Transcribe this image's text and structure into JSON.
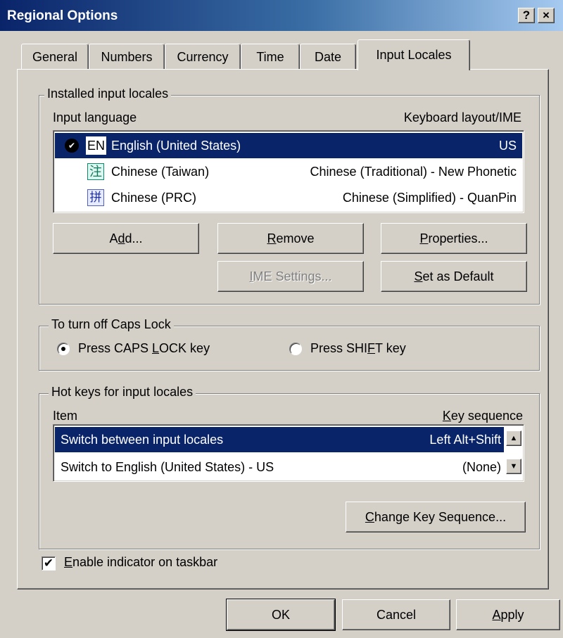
{
  "window": {
    "title": "Regional Options",
    "help_glyph": "?",
    "close_glyph": "×"
  },
  "tabs": [
    {
      "label": "General"
    },
    {
      "label": "Numbers"
    },
    {
      "label": "Currency"
    },
    {
      "label": "Time"
    },
    {
      "label": "Date"
    },
    {
      "label": "Input Locales",
      "active": true
    }
  ],
  "installed": {
    "legend": "Installed input locales",
    "col_language": "Input language",
    "col_layout": "Keyboard layout/IME",
    "rows": [
      {
        "badge": "EN",
        "language": "English (United States)",
        "layout": "US",
        "selected": true,
        "checked": true,
        "icon": "en-locale-icon"
      },
      {
        "badge": "",
        "language": "Chinese (Taiwan)",
        "layout": "Chinese (Traditional) - New Phonetic",
        "selected": false,
        "icon": "phonetic-ime-icon"
      },
      {
        "badge": "",
        "language": "Chinese (PRC)",
        "layout": "Chinese (Simplified) - QuanPin",
        "selected": false,
        "icon": "quanpin-ime-icon"
      }
    ],
    "check_mark": "✔",
    "phonetic_glyph": "注",
    "quanpin_glyph": "拼",
    "buttons": {
      "add_pre": "A",
      "add_key": "d",
      "add_post": "d...",
      "remove_key": "R",
      "remove_post": "emove",
      "properties_key": "P",
      "properties_post": "roperties...",
      "ime_key": "I",
      "ime_post": "ME Settings...",
      "default_key": "S",
      "default_post": "et as Default"
    }
  },
  "caps": {
    "legend": "To turn off Caps Lock",
    "option1_pre": "Press CAPS ",
    "option1_key": "L",
    "option1_post": "OCK key",
    "option2_pre": "Press SHI",
    "option2_key": "F",
    "option2_post": "T key",
    "selected": 1
  },
  "hotkeys": {
    "legend": "Hot keys for input locales",
    "col_item": "Item",
    "col_seq_key": "K",
    "col_seq_post": "ey sequence",
    "rows": [
      {
        "item": "Switch between input locales",
        "sequence": "Left Alt+Shift",
        "selected": true
      },
      {
        "item": "Switch to English (United States) - US",
        "sequence": "(None)",
        "selected": false
      }
    ],
    "change_key": "C",
    "change_post": "hange Key Sequence...",
    "scroll_up": "▲",
    "scroll_down": "▼"
  },
  "indicator": {
    "checked": true,
    "check_glyph": "✔",
    "label_key": "E",
    "label_post": "nable indicator on taskbar"
  },
  "footer": {
    "ok": "OK",
    "cancel": "Cancel",
    "apply_key": "A",
    "apply_post": "pply"
  }
}
